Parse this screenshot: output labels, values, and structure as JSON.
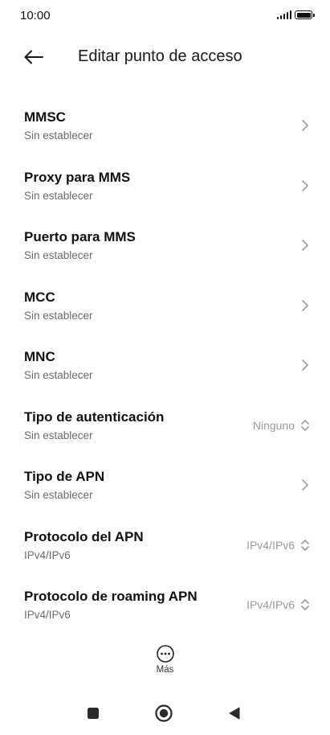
{
  "status_bar": {
    "time": "10:00",
    "battery_level": 1.0
  },
  "app_bar": {
    "title": "Editar punto de acceso",
    "back_icon": "arrow-left-icon"
  },
  "settings": [
    {
      "title": "MMSC",
      "subtitle": "Sin establecer",
      "value": "",
      "control": "chevron-right-icon"
    },
    {
      "title": "Proxy para MMS",
      "subtitle": "Sin establecer",
      "value": "",
      "control": "chevron-right-icon"
    },
    {
      "title": "Puerto para MMS",
      "subtitle": "Sin establecer",
      "value": "",
      "control": "chevron-right-icon"
    },
    {
      "title": "MCC",
      "subtitle": "Sin establecer",
      "value": "",
      "control": "chevron-right-icon"
    },
    {
      "title": "MNC",
      "subtitle": "Sin establecer",
      "value": "",
      "control": "chevron-right-icon"
    },
    {
      "title": "Tipo de autenticación",
      "subtitle": "Sin establecer",
      "value": "Ninguno",
      "control": "chevron-updown-icon"
    },
    {
      "title": "Tipo de APN",
      "subtitle": "Sin establecer",
      "value": "",
      "control": "chevron-right-icon"
    },
    {
      "title": "Protocolo del APN",
      "subtitle": "IPv4/IPv6",
      "value": "IPv4/IPv6",
      "control": "chevron-updown-icon"
    },
    {
      "title": "Protocolo de roaming APN",
      "subtitle": "IPv4/IPv6",
      "value": "IPv4/IPv6",
      "control": "chevron-updown-icon"
    }
  ],
  "footer": {
    "more_label": "Más",
    "more_icon": "more-horizontal-icon"
  },
  "nav_bar": {
    "recent_icon": "square-icon",
    "home_icon": "circle-icon",
    "back_icon": "triangle-back-icon"
  }
}
